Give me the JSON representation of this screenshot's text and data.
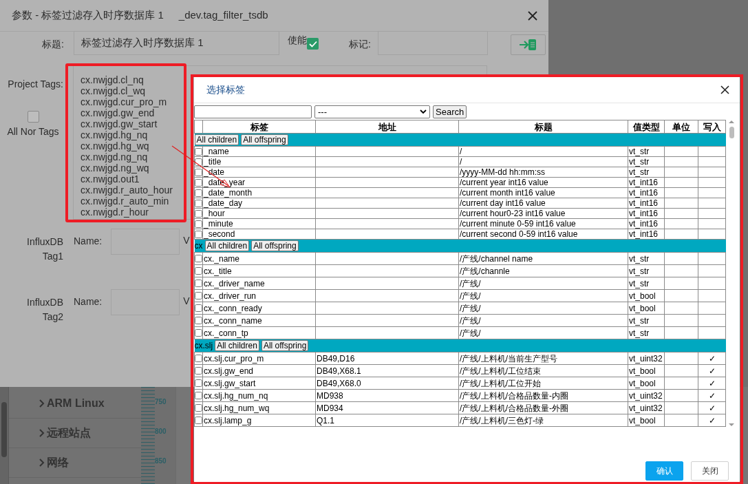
{
  "background": {
    "sidebar_items": [
      {
        "label": "ARM Linux"
      },
      {
        "label": "远程站点"
      },
      {
        "label": "网络"
      }
    ],
    "ruler_labels": [
      "750",
      "800",
      "850"
    ]
  },
  "param_dialog": {
    "title": "参数 - 标签过滤存入时序数据库 1",
    "subtitle": "_dev.tag_filter_tsdb",
    "title_label": "标题:",
    "title_value": "标签过滤存入时序数据库 1",
    "enable_label": "使能",
    "enabled": true,
    "mark_label": "标记:",
    "project_tags_label": "Project Tags:",
    "project_tags": [
      "cx.nwjgd.cl_nq",
      "cx.nwjgd.cl_wq",
      "cx.nwjgd.cur_pro_m",
      "cx.nwjgd.gw_end",
      "cx.nwjgd.gw_start",
      "cx.nwjgd.hg_nq",
      "cx.nwjgd.hg_wq",
      "cx.nwjgd.ng_nq",
      "cx.nwjgd.ng_wq",
      "cx.nwjgd.out1",
      "cx.nwjgd.r_auto_hour",
      "cx.nwjgd.r_auto_min",
      "cx.nwjgd.r_hour"
    ],
    "all_nor_tags": {
      "label": "All Nor Tags",
      "checked": false
    },
    "influx_tags": [
      {
        "label": "InfluxDB Tag1",
        "name_label": "Name:",
        "value_label": "V"
      },
      {
        "label": "InfluxDB Tag2",
        "name_label": "Name:",
        "value_label": "V"
      }
    ]
  },
  "tag_dialog": {
    "title": "选择标签",
    "filter_value": "---",
    "search_button": "Search",
    "columns": [
      "标签",
      "地址",
      "标题",
      "值类型",
      "单位",
      "写入"
    ],
    "groups": [
      {
        "buttons": [
          "All children",
          "All offspring"
        ],
        "rows": [
          {
            "tag": "_name",
            "title": "/",
            "type": "vt_str",
            "checked": false
          },
          {
            "tag": "_title",
            "title": "/",
            "type": "vt_str",
            "checked": false
          },
          {
            "tag": "_date",
            "title": "/yyyy-MM-dd hh:mm:ss",
            "type": "vt_str",
            "checked": false
          },
          {
            "tag": "_date_year",
            "title": "/current year int16 value",
            "type": "vt_int16",
            "checked": false
          },
          {
            "tag": "_date_month",
            "title": "/current month int16 value",
            "type": "vt_int16",
            "checked": false
          },
          {
            "tag": "_date_day",
            "title": "/current day int16 value",
            "type": "vt_int16",
            "checked": false
          },
          {
            "tag": "_hour",
            "title": "/current hour0-23 int16 value",
            "type": "vt_int16",
            "checked": false
          },
          {
            "tag": "_minute",
            "title": "/current minute 0-59 int16 value",
            "type": "vt_int16",
            "checked": false
          },
          {
            "tag": "_second",
            "title": "/current second 0-59 int16 value",
            "type": "vt_int16",
            "checked": false
          }
        ]
      },
      {
        "label": "cx",
        "buttons": [
          "All children",
          "All offspring"
        ],
        "rows": [
          {
            "tag": "cx._name",
            "title": "/产线/channel name",
            "type": "vt_str",
            "checked": false
          },
          {
            "tag": "cx._title",
            "title": "/产线/channle",
            "type": "vt_str",
            "checked": false
          },
          {
            "tag": "cx._driver_name",
            "title": "/产线/",
            "type": "vt_str",
            "checked": false
          },
          {
            "tag": "cx._driver_run",
            "title": "/产线/",
            "type": "vt_bool",
            "checked": false
          },
          {
            "tag": "cx._conn_ready",
            "title": "/产线/",
            "type": "vt_bool",
            "checked": false
          },
          {
            "tag": "cx._conn_name",
            "title": "/产线/",
            "type": "vt_str",
            "checked": false
          },
          {
            "tag": "cx._conn_tp",
            "title": "/产线/",
            "type": "vt_str",
            "checked": false
          }
        ]
      },
      {
        "label": "cx.slj",
        "buttons": [
          "All children",
          "All offspring"
        ],
        "rows": [
          {
            "tag": "cx.slj.cur_pro_m",
            "address": "DB49,D16",
            "title": "/产线/上料机/当前生产型号",
            "type": "vt_uint32",
            "write": "✓",
            "checked": false
          },
          {
            "tag": "cx.slj.gw_end",
            "address": "DB49,X68.1",
            "title": "/产线/上料机/工位结束",
            "type": "vt_bool",
            "write": "✓",
            "checked": false
          },
          {
            "tag": "cx.slj.gw_start",
            "address": "DB49,X68.0",
            "title": "/产线/上料机/工位开始",
            "type": "vt_bool",
            "write": "✓",
            "checked": false
          },
          {
            "tag": "cx.slj.hg_num_nq",
            "address": "MD938",
            "title": "/产线/上料机/合格品数量-内圈",
            "type": "vt_uint32",
            "write": "✓",
            "checked": false
          },
          {
            "tag": "cx.slj.hg_num_wq",
            "address": "MD934",
            "title": "/产线/上料机/合格品数量-外圈",
            "type": "vt_uint32",
            "write": "✓",
            "checked": false
          },
          {
            "tag": "cx.slj.lamp_g",
            "address": "Q1.1",
            "title": "/产线/上料机/三色灯-绿",
            "type": "vt_bool",
            "write": "✓",
            "checked": false
          }
        ]
      }
    ],
    "buttons": [
      {
        "label": "确认",
        "kind": "primary"
      },
      {
        "label": "关闭",
        "kind": "secondary"
      }
    ]
  }
}
